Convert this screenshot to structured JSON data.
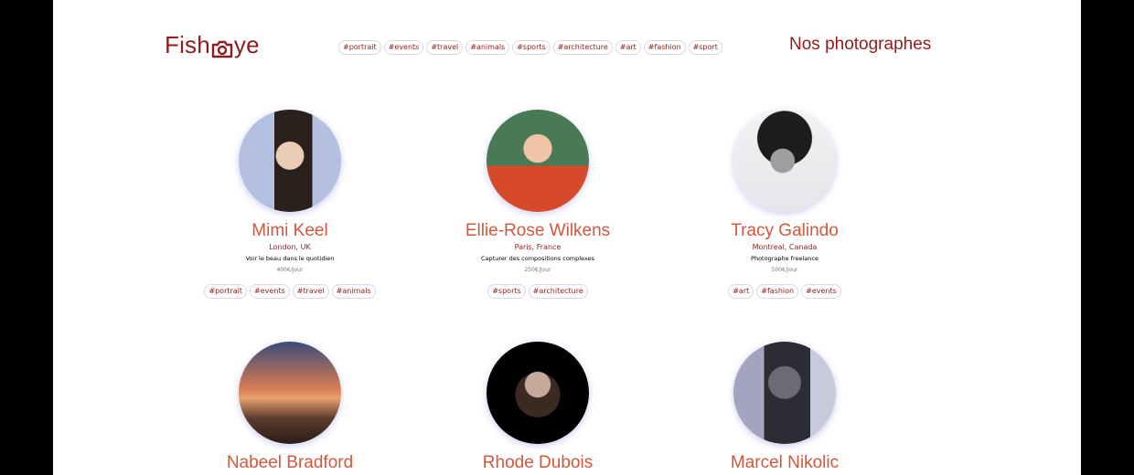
{
  "logo": {
    "text_left": "Fish",
    "text_right": "ye",
    "icon": "camera-icon"
  },
  "nav": {
    "tags": [
      "#portrait",
      "#events",
      "#travel",
      "#animals",
      "#sports",
      "#architecture",
      "#art",
      "#fashion",
      "#sport"
    ]
  },
  "heading": "Nos photographes",
  "photographers": [
    {
      "name": "Mimi Keel",
      "location": "London, UK",
      "tagline": "Voir le beau dans le quotidien",
      "price": "400€/jour",
      "tags": [
        "#portrait",
        "#events",
        "#travel",
        "#animals"
      ]
    },
    {
      "name": "Ellie-Rose Wilkens",
      "location": "Paris, France",
      "tagline": "Capturer des compositions complexes",
      "price": "250€/jour",
      "tags": [
        "#sports",
        "#architecture"
      ]
    },
    {
      "name": "Tracy Galindo",
      "location": "Montreal, Canada",
      "tagline": "Photographe freelance",
      "price": "500€/jour",
      "tags": [
        "#art",
        "#fashion",
        "#events"
      ]
    },
    {
      "name": "Nabeel Bradford"
    },
    {
      "name": "Rhode Dubois"
    },
    {
      "name": "Marcel Nikolic"
    }
  ],
  "colors": {
    "brand": "#901c1c",
    "name": "#d3573c",
    "page": "#ffffff",
    "backdrop": "#000000"
  }
}
